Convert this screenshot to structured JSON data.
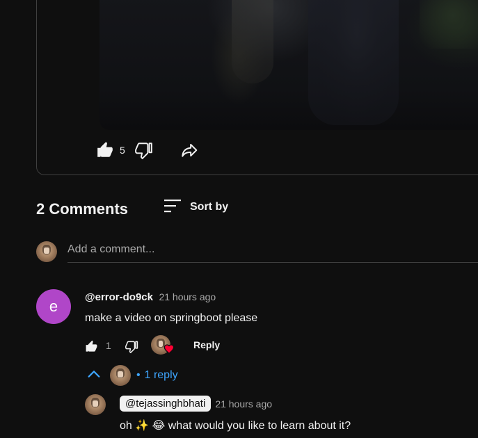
{
  "post": {
    "like_count": "5"
  },
  "comments_section": {
    "count_label": "2 Comments",
    "sort_label": "Sort by",
    "add_comment_placeholder": "Add a comment..."
  },
  "comment": {
    "avatar_letter": "e",
    "avatar_color": "#b046c8",
    "author": "@error-do9ck",
    "time": "21 hours ago",
    "text": "make a video on springboot please",
    "like_count": "1",
    "reply_label": "Reply",
    "replies_dot": "•",
    "replies_count": "1 reply"
  },
  "reply": {
    "author": "@tejassinghbhati",
    "time": "21 hours ago",
    "text": "oh ✨ 😂 what would you like to learn about it?"
  },
  "colors": {
    "background": "#0f0f0f",
    "link_blue": "#3ea6ff",
    "heart_red": "#ff0033"
  }
}
